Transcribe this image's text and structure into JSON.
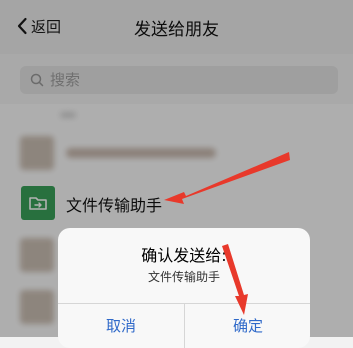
{
  "navbar": {
    "back_label": "返回",
    "title": "发送给朋友"
  },
  "search": {
    "placeholder": "搜索"
  },
  "list": {
    "file_transfer_name": "文件传输助手"
  },
  "dialog": {
    "title": "确认发送给:",
    "recipient": "文件传输助手",
    "cancel_label": "取消",
    "confirm_label": "确定"
  },
  "colors": {
    "accent_blue": "#2f69c9",
    "file_transfer_green": "#3aa15a",
    "annotation_red": "#e8392b"
  }
}
